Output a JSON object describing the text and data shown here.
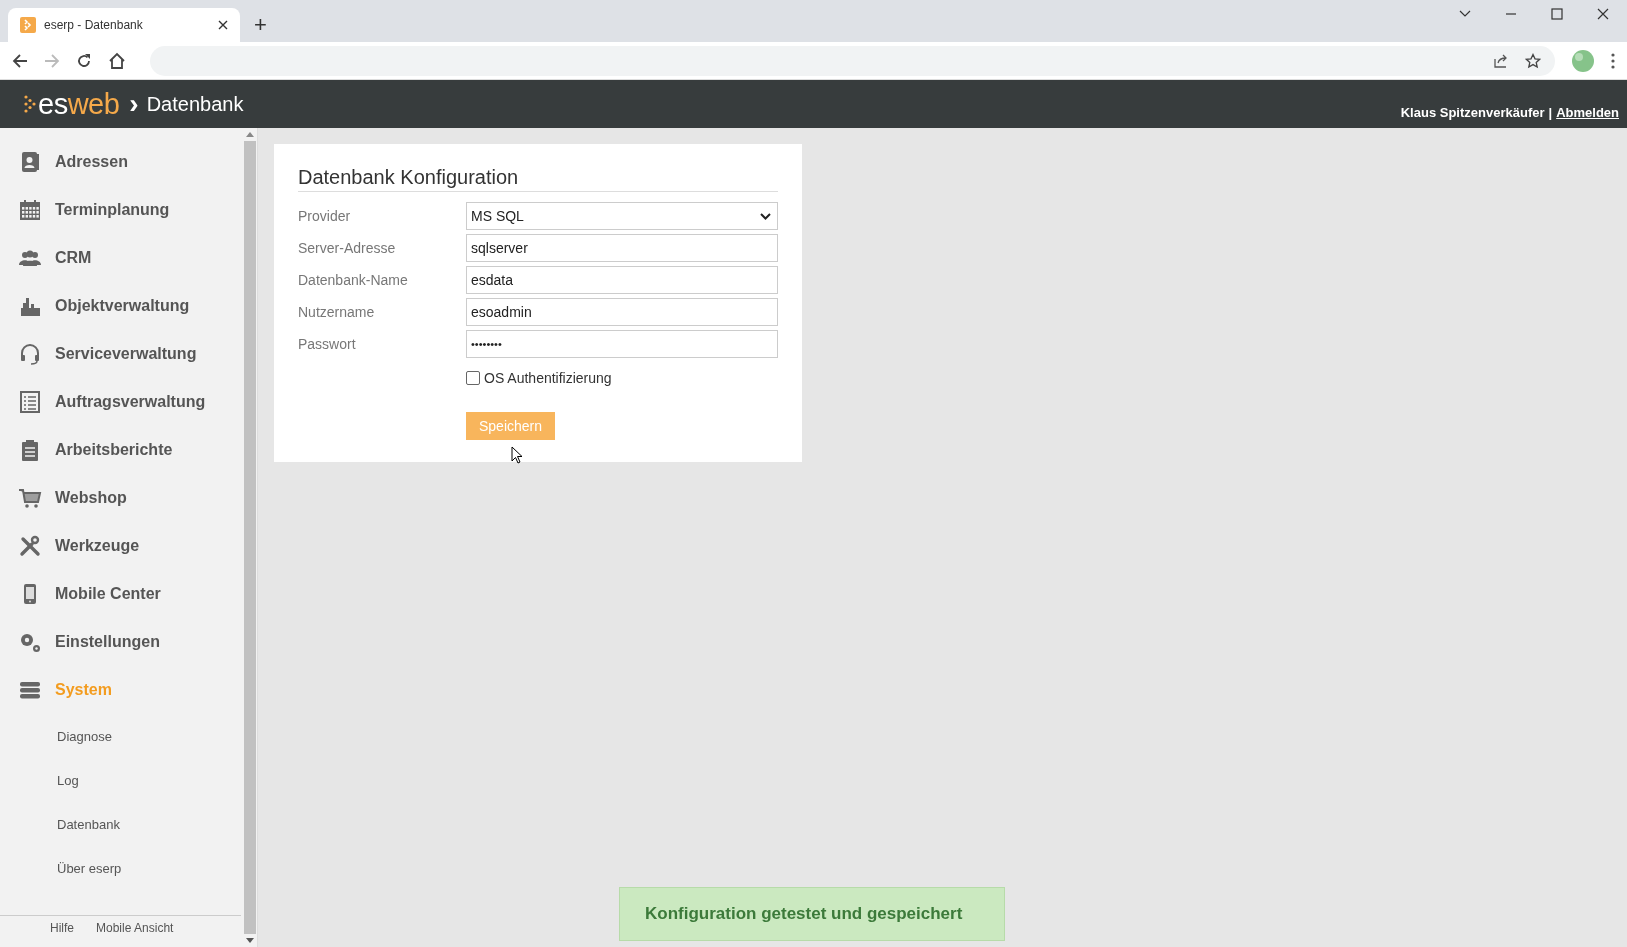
{
  "browser": {
    "tab_title": "eserp - Datenbank",
    "new_tab": "+"
  },
  "header": {
    "logo_text": "es",
    "logo_accent": "web",
    "breadcrumb_sep": "›",
    "page": "Datenbank",
    "user": "Klaus Spitzenverkäufer",
    "separator": "|",
    "logout": "Abmelden"
  },
  "sidebar": {
    "items": [
      {
        "label": "Adressen",
        "selected": false
      },
      {
        "label": "Terminplanung",
        "selected": false
      },
      {
        "label": "CRM",
        "selected": false
      },
      {
        "label": "Objektverwaltung",
        "selected": false
      },
      {
        "label": "Serviceverwaltung",
        "selected": false
      },
      {
        "label": "Auftragsverwaltung",
        "selected": false
      },
      {
        "label": "Arbeitsberichte",
        "selected": false
      },
      {
        "label": "Webshop",
        "selected": false
      },
      {
        "label": "Werkzeuge",
        "selected": false
      },
      {
        "label": "Mobile Center",
        "selected": false
      },
      {
        "label": "Einstellungen",
        "selected": false
      },
      {
        "label": "System",
        "selected": true,
        "children": [
          {
            "label": "Diagnose",
            "selected": false
          },
          {
            "label": "Log",
            "selected": false
          },
          {
            "label": "Datenbank",
            "selected": false
          },
          {
            "label": "Über eserp",
            "selected": false
          }
        ]
      }
    ],
    "footer": [
      "Hilfe",
      "Mobile Ansicht"
    ]
  },
  "form": {
    "title": "Datenbank Konfiguration",
    "fields": [
      {
        "label": "Provider",
        "kind": "select",
        "value": "MS SQL"
      },
      {
        "label": "Server-Adresse",
        "kind": "text",
        "value": "sqlserver"
      },
      {
        "label": "Datenbank-Name",
        "kind": "text",
        "value": "esdata"
      },
      {
        "label": "Nutzername",
        "kind": "text",
        "value": "esoadmin"
      },
      {
        "label": "Passwort",
        "kind": "password",
        "value": "••••••••"
      }
    ],
    "checkbox": {
      "label": "OS Authentifizierung",
      "checked": false
    },
    "button": "Speichern"
  },
  "toast": "Konfiguration getestet und gespeichert"
}
